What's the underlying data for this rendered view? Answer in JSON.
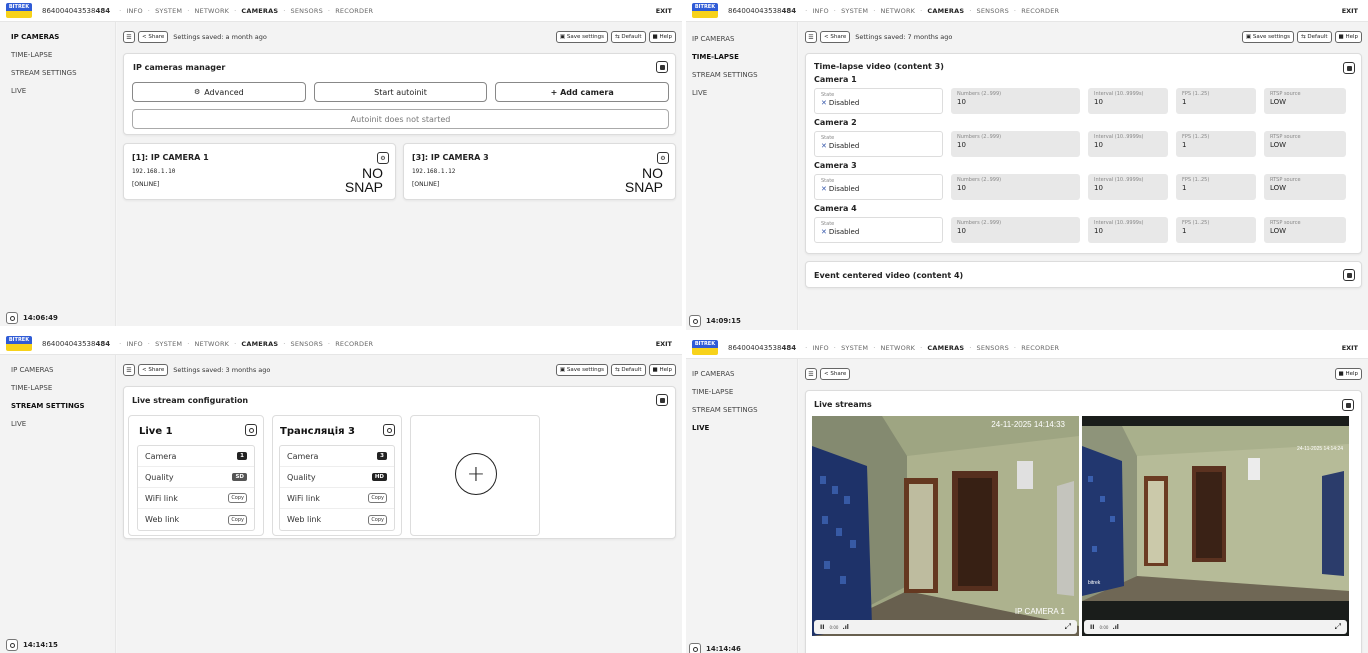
{
  "header": {
    "logo_text": "BITREK",
    "serial_prefix": "864004043538",
    "serial_suffix": "484",
    "nav": [
      "INFO",
      "SYSTEM",
      "NETWORK",
      "CAMERAS",
      "SENSORS",
      "RECORDER"
    ],
    "active_nav": "CAMERAS",
    "exit_label": "EXIT"
  },
  "sidebar": {
    "items": [
      "IP CAMERAS",
      "TIME-LAPSE",
      "STREAM SETTINGS",
      "LIVE"
    ]
  },
  "toolbar": {
    "share_label": "Share",
    "save_label": "Save settings",
    "default_label": "Default",
    "help_label": "Help"
  },
  "panel_ip": {
    "clock": "14:06:49",
    "saved": "Settings saved: a month ago",
    "title": "IP cameras manager",
    "advanced_label": "Advanced",
    "autoinit_label": "Start autoinit",
    "add_label": "+ Add camera",
    "autoinit_status": "Autoinit does not started",
    "cameras": [
      {
        "title": "[1]: IP CAMERA 1",
        "ip": "192.168.1.10",
        "status": "[ONLINE]",
        "snap_line1": "NO",
        "snap_line2": "SNAP"
      },
      {
        "title": "[3]: IP CAMERA 3",
        "ip": "192.168.1.12",
        "status": "[ONLINE]",
        "snap_line1": "NO",
        "snap_line2": "SNAP"
      }
    ]
  },
  "panel_timelapse": {
    "clock": "14:09:15",
    "saved": "Settings saved: 7 months ago",
    "title": "Time-lapse video (content 3)",
    "event_title": "Event centered video (content 4)",
    "labels": {
      "state": "State",
      "numbers": "Numbers (2..999)",
      "interval": "Interval (10..9999s)",
      "fps": "FPS (1..25)",
      "rtsp": "RTSP source"
    },
    "cameras": [
      {
        "name": "Camera 1",
        "state": "Disabled",
        "numbers": "10",
        "interval": "10",
        "fps": "1",
        "rtsp": "LOW"
      },
      {
        "name": "Camera 2",
        "state": "Disabled",
        "numbers": "10",
        "interval": "10",
        "fps": "1",
        "rtsp": "LOW"
      },
      {
        "name": "Camera 3",
        "state": "Disabled",
        "numbers": "10",
        "interval": "10",
        "fps": "1",
        "rtsp": "LOW"
      },
      {
        "name": "Camera 4",
        "state": "Disabled",
        "numbers": "10",
        "interval": "10",
        "fps": "1",
        "rtsp": "LOW"
      }
    ]
  },
  "panel_stream": {
    "clock": "14:14:15",
    "saved": "Settings saved: 3 months ago",
    "title": "Live stream configuration",
    "row_labels": {
      "camera": "Camera",
      "quality": "Quality",
      "wifi": "WiFi link",
      "web": "Web link",
      "copy": "Copy"
    },
    "streams": [
      {
        "title": "Live 1",
        "camera": "1",
        "quality": "SD"
      },
      {
        "title": "Трансляція 3",
        "camera": "3",
        "quality": "HD"
      }
    ],
    "add_symbol": "+"
  },
  "panel_live": {
    "clock": "14:14:46",
    "title": "Live streams",
    "videos": [
      {
        "osd_time": "24-11-2025 14:14:33",
        "osd_name": "IP CAMERA 1",
        "time_code": "0:00"
      },
      {
        "osd_time": "24-11-2025 14:14:24",
        "osd_name": "bitrek",
        "time_code": "0:00"
      }
    ]
  },
  "colors": {
    "logo_blue": "#2f5bd6",
    "logo_yellow": "#f7d21a",
    "x_mark": "#3355aa"
  }
}
